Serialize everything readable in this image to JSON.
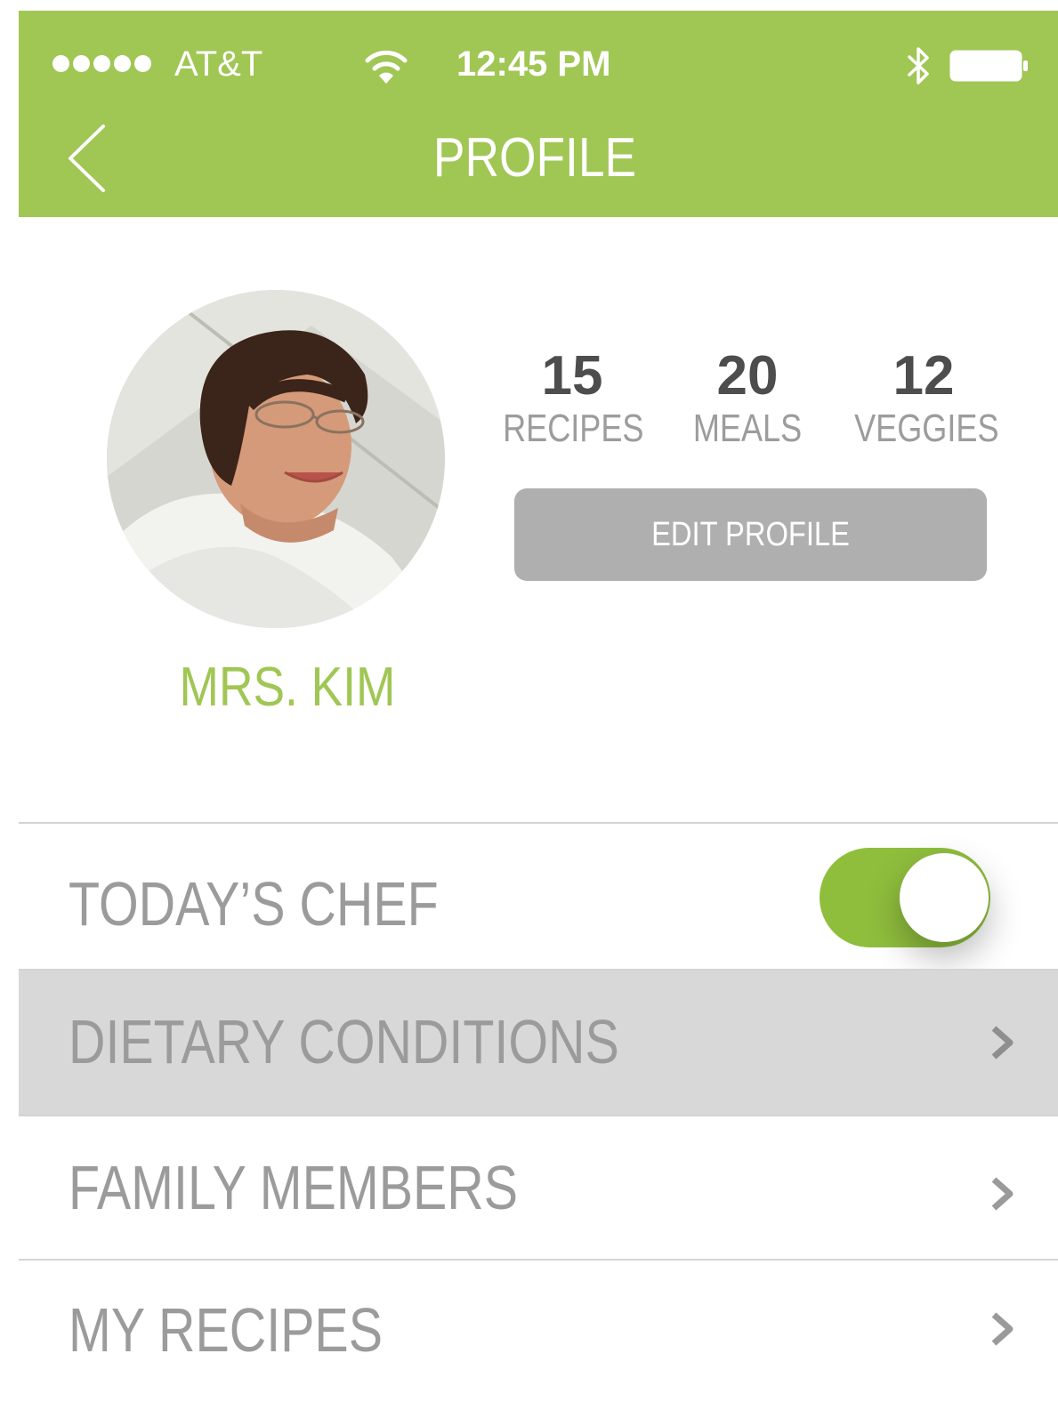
{
  "status_bar": {
    "carrier": "AT&T",
    "time": "12:45 PM",
    "signal_icon": "signal-dots-icon",
    "wifi_icon": "wifi-icon",
    "bluetooth_icon": "bluetooth-icon",
    "battery_icon": "battery-icon"
  },
  "nav": {
    "title": "PROFILE",
    "back_icon": "chevron-left-icon"
  },
  "profile": {
    "name": "MRS. KIM",
    "avatar": "profile-photo",
    "stats": [
      {
        "value": "15",
        "label": "RECIPES"
      },
      {
        "value": "20",
        "label": "MEALS"
      },
      {
        "value": "12",
        "label": "VEGGIES"
      }
    ],
    "edit_button": "EDIT PROFILE"
  },
  "menu": {
    "todays_chef": {
      "label": "TODAY’S CHEF",
      "toggle_on": true
    },
    "dietary_conditions": {
      "label": "DIETARY CONDITIONS"
    },
    "family_members": {
      "label": "FAMILY MEMBERS"
    },
    "my_recipes": {
      "label": "MY RECIPES"
    }
  },
  "colors": {
    "accent": "#a0c654",
    "toggle_on": "#8fbe3d",
    "button_gray": "#afafaf",
    "row_highlight": "#d8d8d8",
    "text_gray": "#9b9b9b",
    "stat_value": "#4d4d4d"
  }
}
